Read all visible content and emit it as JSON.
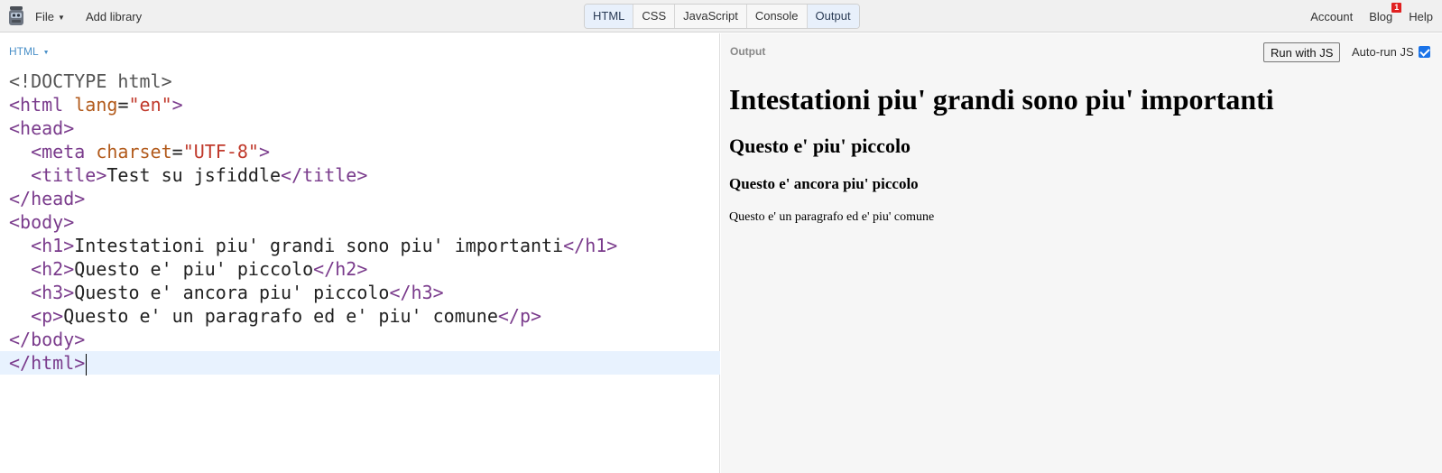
{
  "topbar": {
    "file_label": "File",
    "add_library_label": "Add library",
    "tabs": [
      {
        "label": "HTML",
        "active": true
      },
      {
        "label": "CSS",
        "active": false
      },
      {
        "label": "JavaScript",
        "active": false
      },
      {
        "label": "Console",
        "active": false
      },
      {
        "label": "Output",
        "active": true
      }
    ],
    "right_links": {
      "account": "Account",
      "blog": "Blog",
      "blog_badge": "1",
      "help": "Help"
    }
  },
  "editor": {
    "label": "HTML",
    "lines": {
      "l1": "<!DOCTYPE html>",
      "l2_open": "<html",
      "l2_attr": " lang",
      "l2_eq": "=",
      "l2_val": "\"en\"",
      "l2_close": ">",
      "l3": "<head>",
      "l4_indent": "  ",
      "l4_open": "<meta",
      "l4_attr": " charset",
      "l4_eq": "=",
      "l4_val": "\"UTF-8\"",
      "l4_close": ">",
      "l5_indent": "  ",
      "l5_open": "<title>",
      "l5_text": "Test su jsfiddle",
      "l5_close": "</title>",
      "l6": "</head>",
      "l7": "<body>",
      "l8_indent": "  ",
      "l8_open": "<h1>",
      "l8_text": "Intestationi piu' grandi sono piu' importanti",
      "l8_close": "</h1>",
      "l9_indent": "  ",
      "l9_open": "<h2>",
      "l9_text": "Questo e' piu' piccolo",
      "l9_close": "</h2>",
      "l10_indent": "  ",
      "l10_open": "<h3>",
      "l10_text": "Questo e' ancora piu' piccolo",
      "l10_close": "</h3>",
      "l11_indent": "  ",
      "l11_open": "<p>",
      "l11_text": "Questo e' un paragrafo ed e' piu' comune",
      "l11_close": "</p>",
      "l12": "</body>",
      "l13": "</html>"
    }
  },
  "output": {
    "label": "Output",
    "run_button": "Run with JS",
    "autorun_label": "Auto-run JS",
    "autorun_checked": true,
    "rendered": {
      "h1": "Intestationi piu' grandi sono piu' importanti",
      "h2": "Questo e' piu' piccolo",
      "h3": "Questo e' ancora piu' piccolo",
      "p": "Questo e' un paragrafo ed e' piu' comune"
    }
  },
  "colors": {
    "tag": "#7a3b8c",
    "attribute": "#b25a1b",
    "string": "#c0392b",
    "accent": "#4a90c8",
    "badge": "#e02020"
  }
}
